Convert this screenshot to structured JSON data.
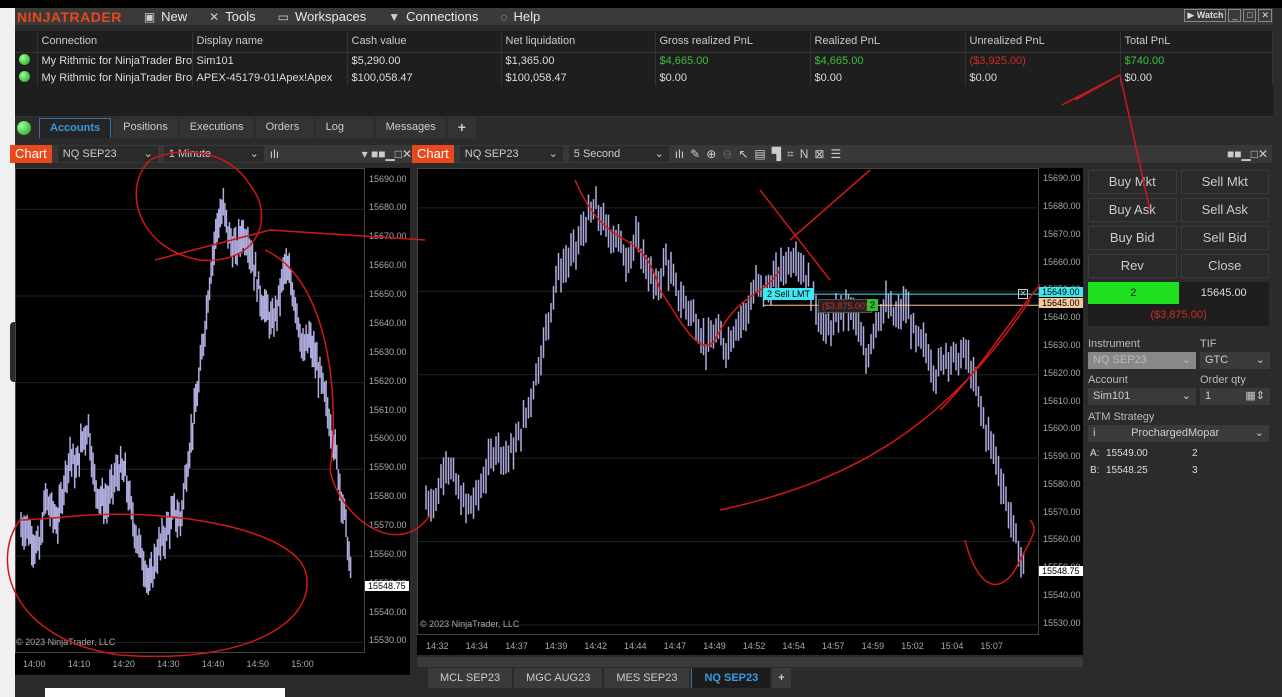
{
  "menu": {
    "logo": "NINJATRADER",
    "items": [
      {
        "label": "New",
        "icon": "▣"
      },
      {
        "label": "Tools",
        "icon": "✕"
      },
      {
        "label": "Workspaces",
        "icon": "▭"
      },
      {
        "label": "Connections",
        "icon": "▼"
      },
      {
        "label": "Help",
        "icon": "◌"
      }
    ],
    "watch": "Watch"
  },
  "accounts": {
    "columns": [
      "Connection",
      "Display name",
      "Cash value",
      "Net liquidation",
      "Gross realized PnL",
      "Realized PnL",
      "Unrealized PnL",
      "Total PnL"
    ],
    "rows": [
      [
        "My Rithmic for NinjaTrader Broke",
        "Sim101",
        "$5,290.00",
        "$1,365.00",
        "$4,665.00",
        "$4,665.00",
        "($3,925.00)",
        "$740.00"
      ],
      [
        "My Rithmic for NinjaTrader Broke",
        "APEX-45179-01!Apex!Apex",
        "$100,058.47",
        "$100,058.47",
        "$0.00",
        "$0.00",
        "$0.00",
        "$0.00"
      ]
    ]
  },
  "tabs": [
    "Accounts",
    "Positions",
    "Executions",
    "Orders",
    "Log",
    "Messages",
    "+"
  ],
  "left_chart": {
    "button": "Chart",
    "instrument": "NQ SEP23",
    "interval": "1 Minute",
    "copyright": "© 2023 NinjaTrader, LLC",
    "last_price": "15548.75",
    "price_ticks": [
      "15690.00",
      "15680.00",
      "15670.00",
      "15660.00",
      "15650.00",
      "15640.00",
      "15630.00",
      "15620.00",
      "15610.00",
      "15600.00",
      "15590.00",
      "15580.00",
      "15570.00",
      "15560.00",
      "15550.00",
      "15540.00",
      "15530.00"
    ],
    "time_ticks": [
      "14:00",
      "14:10",
      "14:20",
      "14:30",
      "14:40",
      "14:50",
      "15:00"
    ],
    "closes": [
      15570,
      15565,
      15562,
      15580,
      15575,
      15572,
      15585,
      15595,
      15590,
      15600,
      15605,
      15585,
      15580,
      15578,
      15585,
      15590,
      15588,
      15575,
      15565,
      15558,
      15550,
      15560,
      15565,
      15570,
      15575,
      15572,
      15590,
      15605,
      15620,
      15640,
      15660,
      15675,
      15680,
      15670,
      15665,
      15672,
      15670,
      15660,
      15650,
      15645,
      15640,
      15648,
      15660,
      15655,
      15645,
      15630,
      15635,
      15628,
      15620,
      15610,
      15600,
      15585,
      15570,
      15548
    ],
    "price_range": [
      15526,
      15694
    ]
  },
  "right_chart": {
    "button": "Chart",
    "instrument": "NQ SEP23",
    "interval": "5 Second",
    "copyright": "© 2023 NinjaTrader, LLC",
    "last_price": "15548.75",
    "order_label": "2  Sell LMT",
    "order_price": "15649.00",
    "position_pnl": "($3,875.00)",
    "position_qty": "2",
    "position_price": "15645.00",
    "price_ticks": [
      "15690.00",
      "15680.00",
      "15670.00",
      "15660.00",
      "15650.00",
      "15640.00",
      "15630.00",
      "15620.00",
      "15610.00",
      "15600.00",
      "15590.00",
      "15580.00",
      "15570.00",
      "15560.00",
      "15550.00",
      "15540.00",
      "15530.00"
    ],
    "time_ticks": [
      "14:32",
      "14:34",
      "14:37",
      "14:39",
      "14:42",
      "14:44",
      "14:47",
      "14:49",
      "14:52",
      "14:54",
      "14:57",
      "14:59",
      "15:02",
      "15:04",
      "15:07"
    ],
    "closes": [
      15575,
      15590,
      15580,
      15572,
      15575,
      15585,
      15595,
      15590,
      15595,
      15605,
      15620,
      15635,
      15655,
      15660,
      15665,
      15675,
      15680,
      15672,
      15670,
      15662,
      15668,
      15660,
      15650,
      15662,
      15650,
      15645,
      15640,
      15630,
      15635,
      15630,
      15638,
      15642,
      15652,
      15650,
      15655,
      15660,
      15664,
      15655,
      15645,
      15635,
      15640,
      15645,
      15640,
      15625,
      15640,
      15645,
      15640,
      15645,
      15632,
      15630,
      15620,
      15628,
      15625,
      15628,
      15615,
      15600,
      15590,
      15575,
      15560,
      15548
    ],
    "price_range": [
      15526,
      15694
    ]
  },
  "chart_trader": {
    "buttons": [
      "Buy Mkt",
      "Sell Mkt",
      "Buy Ask",
      "Sell Ask",
      "Buy Bid",
      "Sell Bid",
      "Rev",
      "Close"
    ],
    "position_qty": "2",
    "avg_price": "15645.00",
    "unrealized": "($3,875.00)",
    "instrument_label": "Instrument",
    "instrument": "NQ SEP23",
    "tif_label": "TIF",
    "tif": "GTC",
    "account_label": "Account",
    "account": "Sim101",
    "qty_label": "Order qty",
    "qty": "1",
    "atm_label": "ATM Strategy",
    "atm": "ProchargedMopar",
    "ask_label": "A:",
    "ask": "15549.00",
    "ask_size": "2",
    "bid_label": "B:",
    "bid": "15548.25",
    "bid_size": "3"
  },
  "instrument_tabs": [
    "MCL SEP23",
    "MGC AUG23",
    "MES SEP23",
    "NQ SEP23",
    "+"
  ],
  "colors": {
    "accent": "#e8481c",
    "up": "#3fbf3f",
    "down": "#d12b2b",
    "order": "#3ee8f0",
    "position": "#f5c99b",
    "bar": "#b0aee0"
  }
}
